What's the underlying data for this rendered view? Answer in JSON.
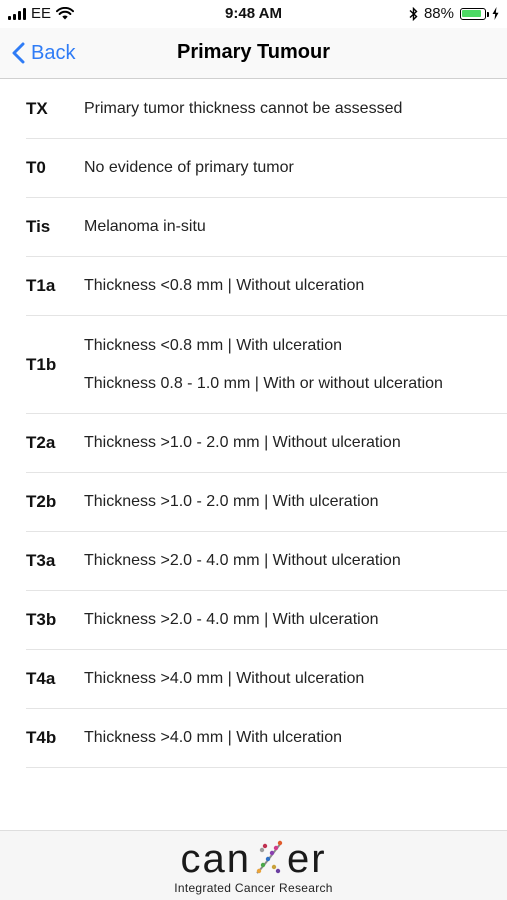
{
  "status_bar": {
    "carrier": "EE",
    "time": "9:48 AM",
    "battery_text": "88%",
    "battery_level": 0.88
  },
  "nav": {
    "back_label": "Back",
    "title": "Primary Tumour"
  },
  "rows": [
    {
      "code": "TX",
      "lines": [
        "Primary tumor thickness cannot be assessed"
      ]
    },
    {
      "code": "T0",
      "lines": [
        "No evidence of primary tumor"
      ]
    },
    {
      "code": "Tis",
      "lines": [
        "Melanoma in-situ"
      ]
    },
    {
      "code": "T1a",
      "lines": [
        "Thickness <0.8 mm  |  Without ulceration"
      ]
    },
    {
      "code": "T1b",
      "lines": [
        "Thickness <0.8 mm  |  With ulceration",
        "Thickness 0.8 - 1.0 mm  |  With or without ulceration"
      ]
    },
    {
      "code": "T2a",
      "lines": [
        "Thickness >1.0 - 2.0 mm  |  Without ulceration"
      ]
    },
    {
      "code": "T2b",
      "lines": [
        "Thickness >1.0 - 2.0 mm  |  With ulceration"
      ]
    },
    {
      "code": "T3a",
      "lines": [
        "Thickness >2.0 - 4.0 mm  |  Without ulceration"
      ]
    },
    {
      "code": "T3b",
      "lines": [
        "Thickness >2.0 - 4.0 mm  |  With ulceration"
      ]
    },
    {
      "code": "T4a",
      "lines": [
        "Thickness >4.0 mm  |  Without ulceration"
      ]
    },
    {
      "code": "T4b",
      "lines": [
        "Thickness >4.0 mm  |  With ulceration"
      ]
    }
  ],
  "footer": {
    "logo_left": "can",
    "logo_right": "er",
    "logo_subtitle": "Integrated Cancer Research"
  },
  "colors": {
    "accent": "#2f7cf6",
    "battery": "#4cd964"
  }
}
